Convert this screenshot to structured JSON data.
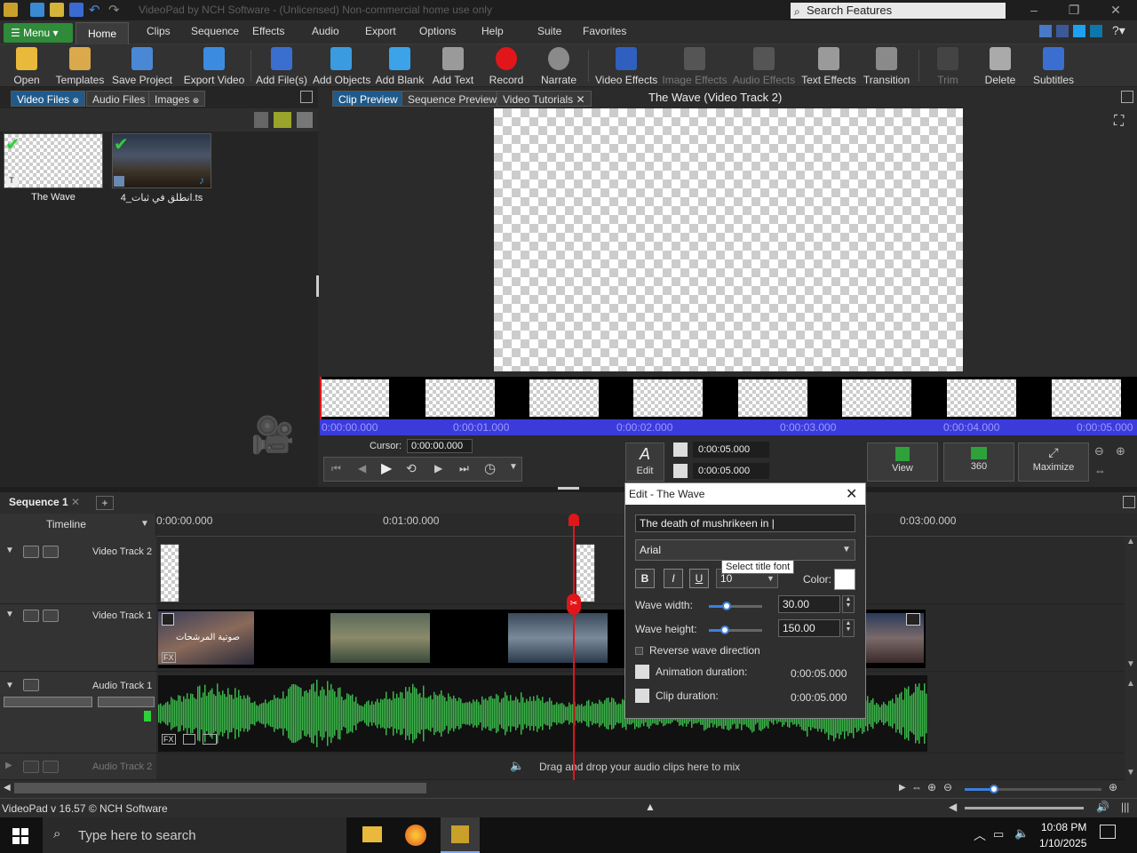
{
  "titlebar": {
    "title": "VideoPad by NCH Software - (Unlicensed) Non-commercial home use only",
    "search_placeholder": "Search Features"
  },
  "menubar": {
    "menu_label": "Menu",
    "tabs": [
      "Home",
      "Clips",
      "Sequence",
      "Effects",
      "Audio",
      "Export",
      "Options",
      "Help",
      "Suite",
      "Favorites"
    ]
  },
  "toolbar": {
    "buttons": [
      {
        "label": "Open",
        "icon": "folder-icon"
      },
      {
        "label": "Templates",
        "icon": "templates-icon"
      },
      {
        "label": "Save Project",
        "icon": "save-icon"
      },
      {
        "label": "Export Video",
        "icon": "export-video-icon"
      },
      {
        "label": "Add File(s)",
        "icon": "add-file-icon"
      },
      {
        "label": "Add Objects",
        "icon": "add-objects-icon"
      },
      {
        "label": "Add Blank",
        "icon": "add-blank-icon"
      },
      {
        "label": "Add Text",
        "icon": "add-text-icon"
      },
      {
        "label": "Record",
        "icon": "record-icon"
      },
      {
        "label": "Narrate",
        "icon": "microphone-icon"
      },
      {
        "label": "Video Effects",
        "icon": "video-effects-icon"
      },
      {
        "label": "Image Effects",
        "icon": "image-effects-icon"
      },
      {
        "label": "Audio Effects",
        "icon": "audio-effects-icon"
      },
      {
        "label": "Text Effects",
        "icon": "text-effects-icon"
      },
      {
        "label": "Transition",
        "icon": "transition-icon"
      },
      {
        "label": "Trim",
        "icon": "trim-icon"
      },
      {
        "label": "Delete",
        "icon": "trash-icon"
      },
      {
        "label": "Subtitles",
        "icon": "subtitles-icon"
      }
    ]
  },
  "bins": {
    "tabs": [
      "Video Files",
      "Audio Files",
      "Images"
    ],
    "items": [
      {
        "name": "The Wave"
      },
      {
        "name": "انطلق في ثبات_4.ts"
      }
    ]
  },
  "preview": {
    "tabs": [
      "Clip Preview",
      "Sequence Preview",
      "Video Tutorials"
    ],
    "title": "The Wave (Video Track 2)",
    "timeline_labels": [
      "0:00:00.000",
      "0:00:01.000",
      "0:00:02.000",
      "0:00:03.000",
      "0:00:04.000",
      "0:00:05.000"
    ],
    "cursor_label": "Cursor:",
    "cursor_value": "0:00:00.000",
    "edit_label": "Edit",
    "time_in": "0:00:05.000",
    "time_out": "0:00:05.000",
    "view_label": "View",
    "vr_label": "360",
    "maximize_label": "Maximize"
  },
  "sequence": {
    "tab": "Sequence 1",
    "timeline_label": "Timeline",
    "ruler_labels": [
      "0:00:00.000",
      "0:01:00.000",
      "0:03:00.000"
    ],
    "tracks": [
      {
        "name": "Video Track 2"
      },
      {
        "name": "Video Track 1"
      },
      {
        "name": "Audio Track 1"
      },
      {
        "name": "Audio Track 2"
      }
    ],
    "drop_hint": "Drag and drop your audio clips here to mix",
    "clip_overlay_text": "صوتية المرشحات"
  },
  "dialog": {
    "title": "Edit - The Wave",
    "text_value": "The death of mushrikeen in |",
    "font": "Arial",
    "bold": "B",
    "italic": "I",
    "underline": "U",
    "size": "10",
    "tooltip": "Select title font",
    "color_label": "Color:",
    "wave_width_label": "Wave width:",
    "wave_width": "30.00",
    "wave_height_label": "Wave height:",
    "wave_height": "150.00",
    "reverse_label": "Reverse wave direction",
    "anim_label": "Animation duration:",
    "anim_value": "0:00:05.000",
    "clip_label": "Clip duration:",
    "clip_value": "0:00:05.000"
  },
  "status": {
    "version": "VideoPad v 16.57 © NCH Software"
  },
  "taskbar": {
    "search_placeholder": "Type here to search",
    "time": "10:08 PM",
    "date": "1/10/2025"
  },
  "colors": {
    "accent": "#2f8a3a",
    "selection_blue": "#1f5a8a",
    "waveform": "#3cb54a",
    "playhead": "#e0161b",
    "timeline_blue": "#3b3bdc"
  }
}
